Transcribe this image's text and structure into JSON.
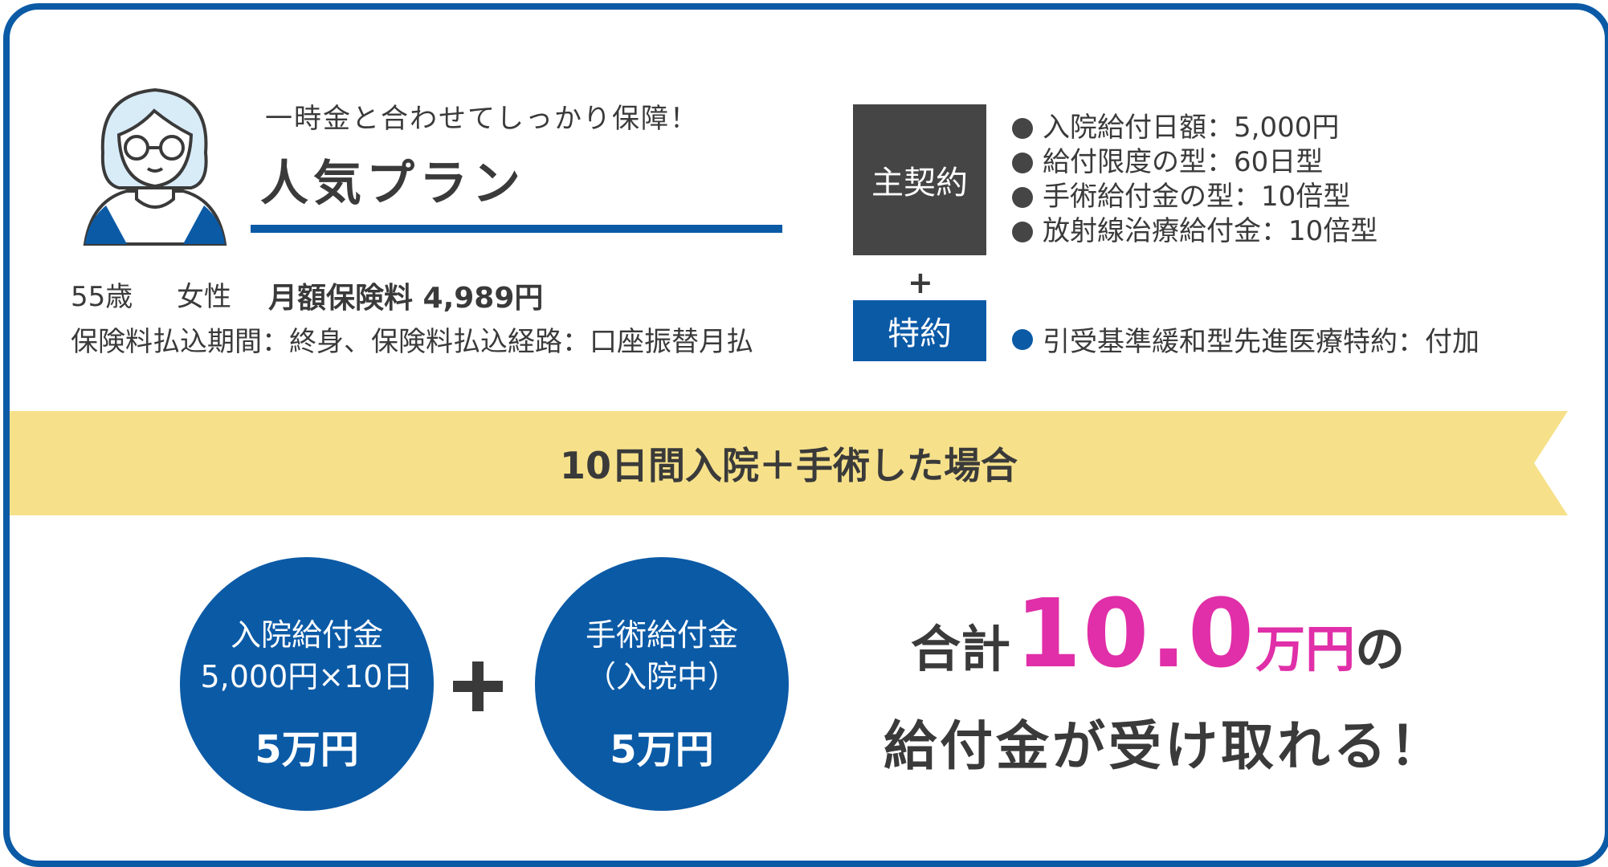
{
  "colors": {
    "brand_blue": "#0b5aa6",
    "dark_gray": "#454545",
    "banner_yellow": "#f6e18a",
    "highlight_pink": "#e02fa8"
  },
  "icons": {
    "avatar": "woman-with-glasses-avatar-icon",
    "plus": "plus-icon"
  },
  "header": {
    "subtitle": "一時金と合わせてしっかり保障！",
    "title": "人気プラン"
  },
  "profile": {
    "age": "55歳",
    "gender": "女性",
    "premium": "月額保険料 4,989円",
    "terms": "保険料払込期間：終身、保険料払込経路：口座振替月払"
  },
  "contract": {
    "main_label": "主契約",
    "plus_symbol": "+",
    "rider_label": "特約",
    "main_items": [
      "入院給付日額：5,000円",
      "給付限度の型：60日型",
      "手術給付金の型：10倍型",
      "放射線治療給付金：10倍型"
    ],
    "rider_item": "引受基準緩和型先進医療特約：付加"
  },
  "scenario": {
    "banner": "10日間入院＋手術した場合"
  },
  "benefits": [
    {
      "line1": "入院給付金",
      "line2": "5,000円×10日",
      "amount": "5万円"
    },
    {
      "line1": "手術給付金",
      "line2": "（入院中）",
      "amount": "5万円"
    }
  ],
  "total": {
    "prefix": "合計",
    "number": "10.0",
    "unit": "万円",
    "suffix": "の",
    "line2": "給付金が受け取れる！"
  }
}
